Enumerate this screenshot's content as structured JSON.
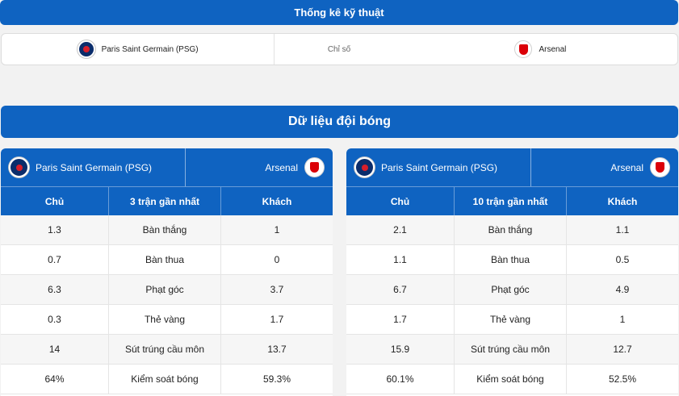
{
  "header": {
    "title": "Thống kê kỹ thuật"
  },
  "teams_row": {
    "home_name": "Paris Saint Germain (PSG)",
    "middle": "Chỉ số",
    "away_name": "Arsenal"
  },
  "section": {
    "title": "Dữ liệu đội bóng"
  },
  "panels": [
    {
      "home_name": "Paris Saint Germain (PSG)",
      "away_name": "Arsenal",
      "col_home": "Chủ",
      "col_mid": "3 trận gần nhất",
      "col_away": "Khách",
      "rows": [
        {
          "home": "1.3",
          "label": "Bàn thắng",
          "away": "1"
        },
        {
          "home": "0.7",
          "label": "Bàn thua",
          "away": "0"
        },
        {
          "home": "6.3",
          "label": "Phạt góc",
          "away": "3.7"
        },
        {
          "home": "0.3",
          "label": "Thẻ vàng",
          "away": "1.7"
        },
        {
          "home": "14",
          "label": "Sút trúng cầu môn",
          "away": "13.7"
        },
        {
          "home": "64%",
          "label": "Kiểm soát bóng",
          "away": "59.3%"
        }
      ]
    },
    {
      "home_name": "Paris Saint Germain (PSG)",
      "away_name": "Arsenal",
      "col_home": "Chủ",
      "col_mid": "10 trận gần nhất",
      "col_away": "Khách",
      "rows": [
        {
          "home": "2.1",
          "label": "Bàn thắng",
          "away": "1.1"
        },
        {
          "home": "1.1",
          "label": "Bàn thua",
          "away": "0.5"
        },
        {
          "home": "6.7",
          "label": "Phạt góc",
          "away": "4.9"
        },
        {
          "home": "1.7",
          "label": "Thẻ vàng",
          "away": "1"
        },
        {
          "home": "15.9",
          "label": "Sút trúng cầu môn",
          "away": "12.7"
        },
        {
          "home": "60.1%",
          "label": "Kiểm soát bóng",
          "away": "52.5%"
        }
      ]
    }
  ],
  "colors": {
    "primary": "#0f63c1",
    "psg": "#0b2d6b",
    "arsenal": "#db0007"
  },
  "icons": {
    "home": "psg-logo-icon",
    "away": "arsenal-logo-icon"
  }
}
